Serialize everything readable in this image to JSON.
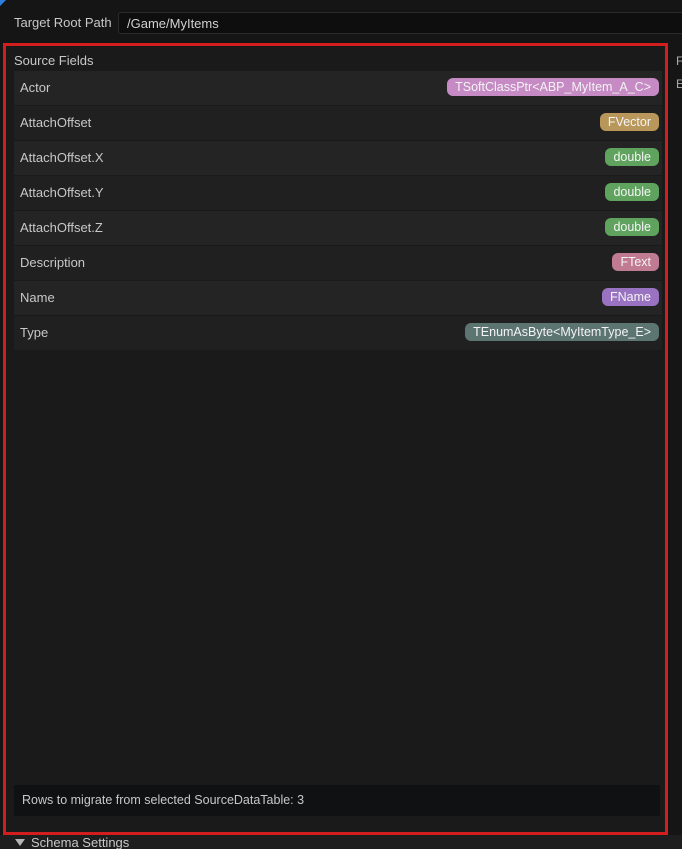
{
  "target_root_path": {
    "label": "Target Root Path",
    "value": "/Game/MyItems"
  },
  "right_panel_peek": {
    "line1": "F",
    "line2": "E"
  },
  "source_fields": {
    "title": "Source Fields",
    "rows": [
      {
        "name": "Actor",
        "type": "TSoftClassPtr<ABP_MyItem_A_C>",
        "color": "#c68ac4"
      },
      {
        "name": "AttachOffset",
        "type": "FVector",
        "color": "#b9975b"
      },
      {
        "name": "AttachOffset.X",
        "type": "double",
        "color": "#5fa35f"
      },
      {
        "name": "AttachOffset.Y",
        "type": "double",
        "color": "#5fa35f"
      },
      {
        "name": "AttachOffset.Z",
        "type": "double",
        "color": "#5fa35f"
      },
      {
        "name": "Description",
        "type": "FText",
        "color": "#c07a92"
      },
      {
        "name": "Name",
        "type": "FName",
        "color": "#9a72c2"
      },
      {
        "name": "Type",
        "type": "TEnumAsByte<MyItemType_E>",
        "color": "#5c7571"
      }
    ]
  },
  "footer": {
    "rows_text": "Rows to migrate from selected SourceDataTable: 3"
  },
  "schema_settings": {
    "label": "Schema Settings"
  }
}
